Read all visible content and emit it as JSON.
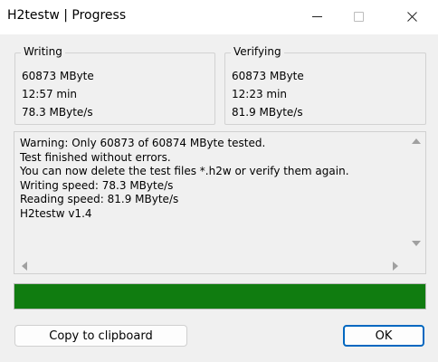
{
  "window": {
    "title": "H2testw | Progress"
  },
  "writing": {
    "legend": "Writing",
    "size": "60873 MByte",
    "time": "12:57 min",
    "speed": "78.3 MByte/s"
  },
  "verifying": {
    "legend": "Verifying",
    "size": "60873 MByte",
    "time": "12:23 min",
    "speed": "81.9 MByte/s"
  },
  "log": {
    "lines": [
      "Warning: Only 60873 of 60874 MByte tested.",
      "Test finished without errors.",
      "You can now delete the test files *.h2w or verify them again.",
      "Writing speed: 78.3 MByte/s",
      "Reading speed: 81.9 MByte/s",
      "H2testw v1.4"
    ]
  },
  "progress": {
    "fraction": 1.0,
    "color": "#107c10"
  },
  "buttons": {
    "copy_label": "Copy to clipboard",
    "ok_label": "OK",
    "ok_border_color": "#0067c0"
  },
  "icons": {
    "minimize": "minimize-icon",
    "maximize": "maximize-icon",
    "close": "close-icon"
  }
}
